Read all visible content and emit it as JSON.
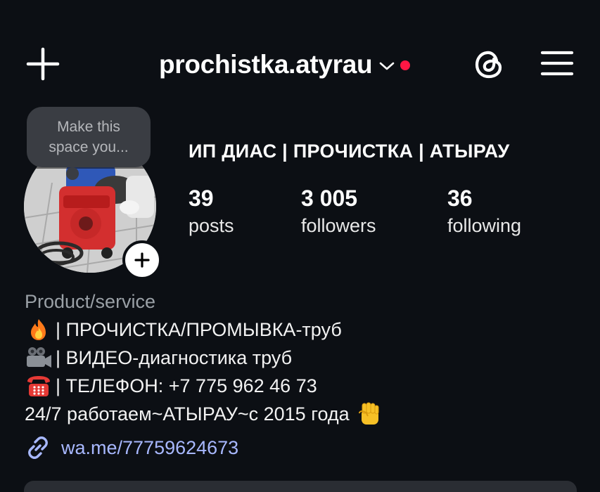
{
  "header": {
    "username": "prochistka.atyrau",
    "accent_dot_color": "#ff1744"
  },
  "profile": {
    "note_line1": "Make this",
    "note_line2": "space you...",
    "full_name": "ИП ДИАС | ПРОЧИСТКА | АТЫРАУ",
    "stats": {
      "posts_count": "39",
      "posts_label": "posts",
      "followers_count": "3 005",
      "followers_label": "followers",
      "following_count": "36",
      "following_label": "following"
    }
  },
  "bio": {
    "category": "Product/service",
    "line1": "| ПРОЧИСТКА/ПРОМЫВКА-труб",
    "line1_icon": "fire-emoji",
    "line2": "| ВИДЕО-диагностика труб",
    "line2_icon": "movie-camera-emoji",
    "line3": "| ТЕЛЕФОН: +7 775 962 46 73",
    "line3_icon": "telephone-emoji",
    "line4": "24/7 работаем~АТЫРАУ~с 2015 года",
    "line4_icon": "raised-fist-emoji",
    "link": "wa.me/77759624673",
    "link_color": "#a8b8ff"
  },
  "icons": {
    "new_post": "plus-icon",
    "dropdown": "chevron-down-icon",
    "threads": "threads-icon",
    "menu": "hamburger-menu-icon",
    "add_story": "plus-icon",
    "link": "link-icon"
  }
}
